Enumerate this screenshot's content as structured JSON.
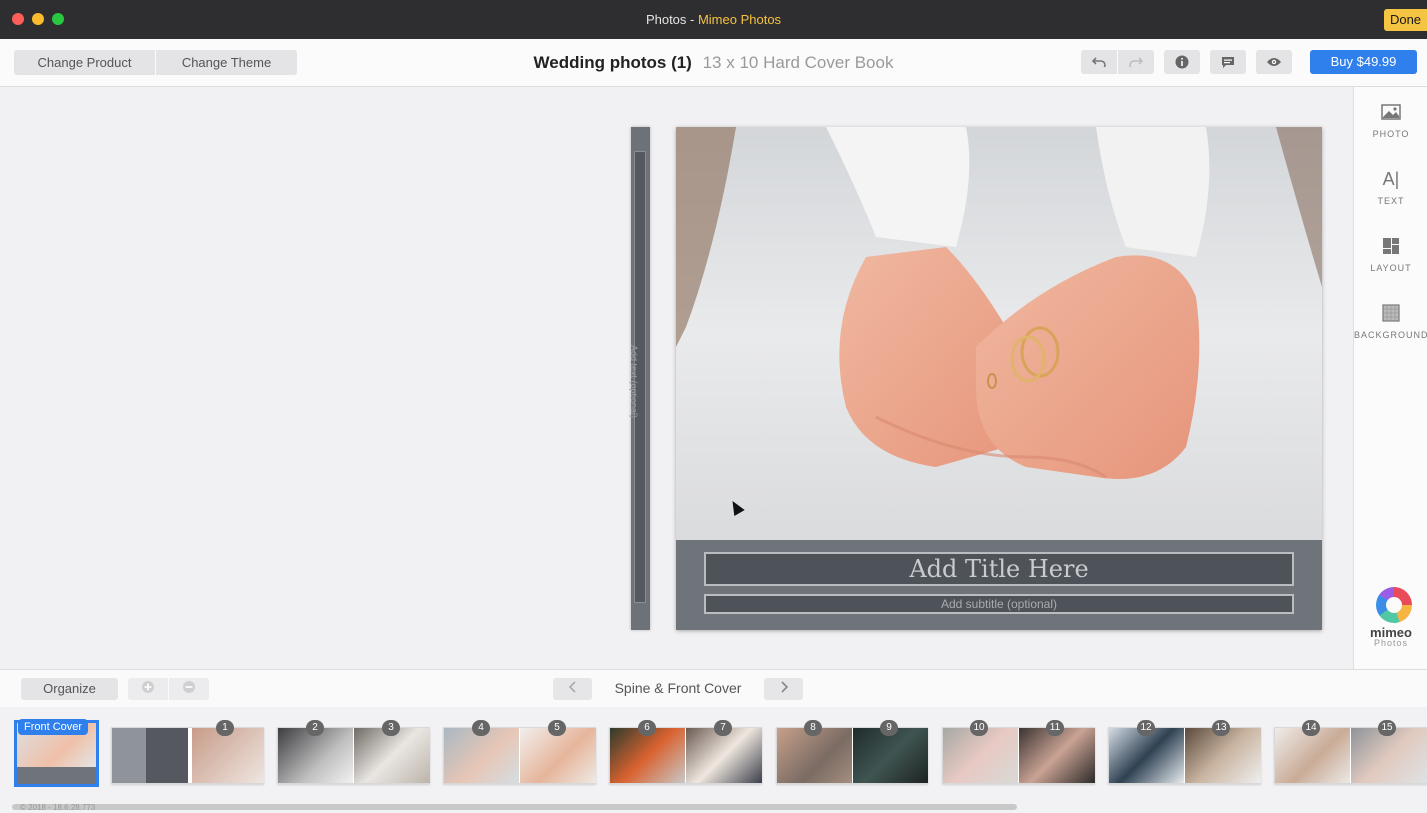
{
  "window": {
    "title_prefix": "Photos - ",
    "title_app": "Mimeo Photos",
    "done_label": "Done"
  },
  "toolbar": {
    "change_product": "Change Product",
    "change_theme": "Change Theme",
    "doc_name": "Wedding photos (1)",
    "doc_product": "13 x 10 Hard Cover Book",
    "undo_icon": "undo-icon",
    "redo_icon": "redo-icon",
    "info_icon": "info-icon",
    "comment_icon": "comment-icon",
    "preview_icon": "eye-icon",
    "buy_label": "Buy $49.99"
  },
  "cover": {
    "spine_placeholder": "Add text (optional)",
    "title_placeholder": "Add Title Here",
    "subtitle_placeholder": "Add subtitle (optional)"
  },
  "right_panel": {
    "tools": [
      {
        "label": "PHOTO",
        "icon": "photo-icon"
      },
      {
        "label": "TEXT",
        "icon": "text-icon"
      },
      {
        "label": "LAYOUT",
        "icon": "layout-icon"
      },
      {
        "label": "BACKGROUND",
        "icon": "background-icon"
      }
    ],
    "logo_word": "mimeo",
    "logo_sub": "Photos"
  },
  "bottom_bar": {
    "organize_label": "Organize",
    "add_icon": "plus-icon",
    "remove_icon": "minus-icon",
    "current_page": "Spine & Front Cover",
    "prev_icon": "chevron-left-icon",
    "next_icon": "chevron-right-icon"
  },
  "filmstrip": {
    "cover_label": "Front Cover",
    "page_numbers": [
      "1",
      "2",
      "3",
      "4",
      "5",
      "6",
      "7",
      "8",
      "9",
      "10",
      "11",
      "12",
      "13",
      "14",
      "15"
    ]
  },
  "footer": {
    "copyright": "© 2018 - 18.6.28.773"
  },
  "colors": {
    "accent": "#2f80ed",
    "done": "#f6c443",
    "titlebar": "#2e2e30"
  }
}
